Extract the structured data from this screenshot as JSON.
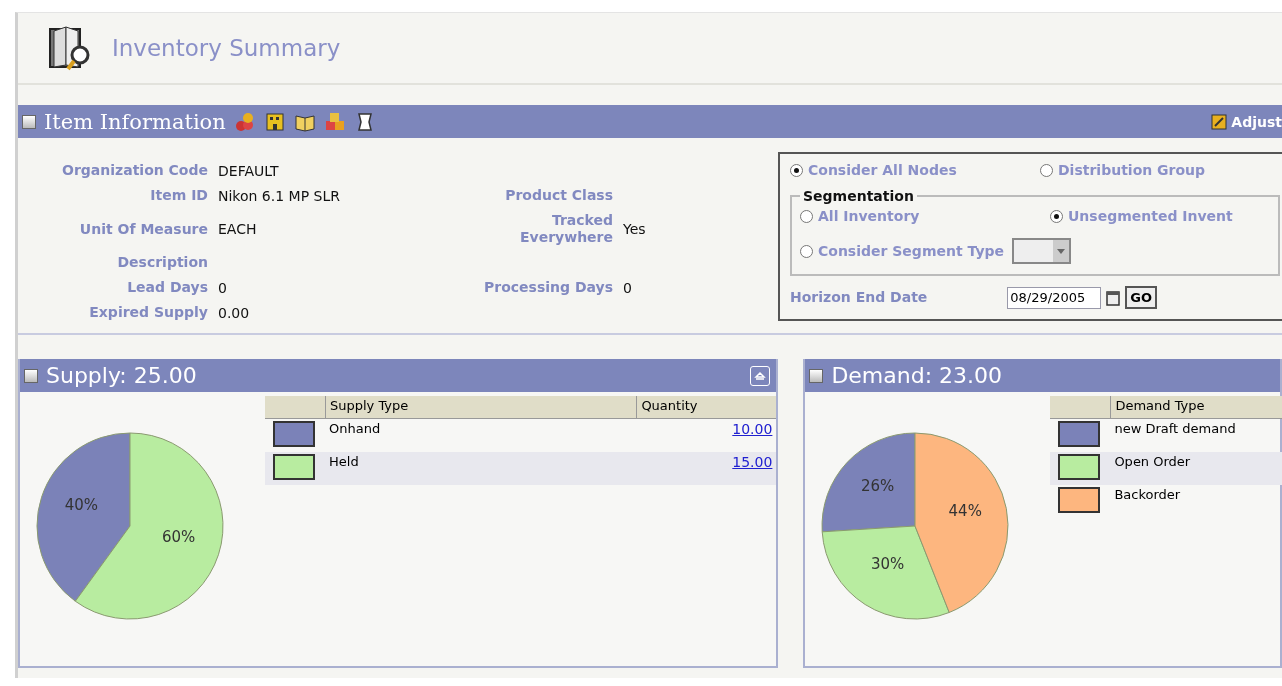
{
  "page_title": "Inventory Summary",
  "item_information": {
    "title": "Item Information",
    "adjust_link": "Adjust",
    "rows": [
      {
        "left": {
          "label": "Organization Code",
          "value": "DEFAULT"
        }
      },
      {
        "left": {
          "label": "Item ID",
          "value": "Nikon 6.1 MP SLR"
        },
        "right": {
          "label": "Product Class"
        }
      },
      {
        "left": {
          "label": "Unit Of Measure",
          "value": "EACH"
        },
        "right": {
          "label": "Tracked Everywhere",
          "value": "Yes"
        }
      },
      {
        "left": {
          "label": "Description"
        }
      },
      {
        "left": {
          "label": "Lead Days",
          "value": "0"
        },
        "right": {
          "label": "Processing Days",
          "value": "0"
        }
      },
      {
        "left": {
          "label": "Expired Supply",
          "value": "0.00"
        }
      }
    ],
    "node_options": [
      {
        "label": "Consider All Nodes",
        "selected": true
      },
      {
        "label": "Distribution Group",
        "selected": false
      }
    ],
    "segmentation": {
      "title": "Segmentation",
      "options": [
        {
          "label": "All Inventory",
          "selected": false
        },
        {
          "label": "Unsegmented Invent",
          "selected": true
        },
        {
          "label": "Consider Segment Type",
          "selected": false
        }
      ]
    },
    "horizon": {
      "label": "Horizon End Date",
      "value": "08/29/2005",
      "button": "GO"
    }
  },
  "panels": [
    {
      "title": "Supply: 25.00",
      "collapse_button": true,
      "columns": [
        "Supply Type",
        "Quantity"
      ],
      "rows": [
        {
          "type": "Onhand",
          "quantity": "10.00",
          "color": "#7b82b8"
        },
        {
          "type": "Held",
          "quantity": "15.00",
          "color": "#b8eca0"
        }
      ],
      "chart_data": {
        "type": "pie",
        "values": [
          40,
          60
        ],
        "colors": [
          "#7b82b8",
          "#b8eca0"
        ],
        "value_labels": [
          "40%",
          "60%"
        ]
      }
    },
    {
      "title": "Demand: 23.00",
      "collapse_button": false,
      "columns": [
        "Demand Type"
      ],
      "rows": [
        {
          "type": "new Draft demand",
          "color": "#7b82b8"
        },
        {
          "type": "Open Order",
          "color": "#b8eca0"
        },
        {
          "type": "Backorder",
          "color": "#fdb67f"
        }
      ],
      "chart_data": {
        "type": "pie",
        "values": [
          26,
          30,
          44
        ],
        "colors": [
          "#7b82b8",
          "#b8eca0",
          "#fdb67f"
        ],
        "value_labels": [
          "26%",
          "30%",
          "44%"
        ]
      }
    }
  ]
}
